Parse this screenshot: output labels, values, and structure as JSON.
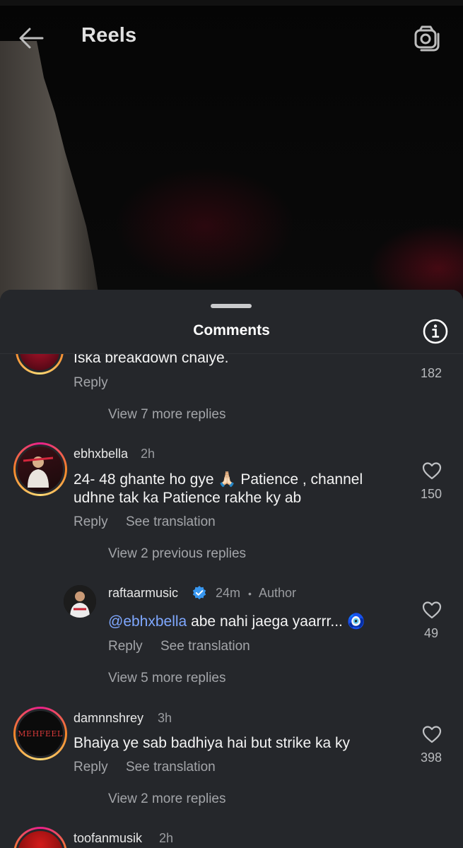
{
  "header": {
    "title": "Reels",
    "back_icon": "arrow-left-icon",
    "camera_icon": "camera-icon"
  },
  "sheet": {
    "title": "Comments",
    "info_icon": "info-icon"
  },
  "comments": [
    {
      "text": "Iska breakdown chaiye.",
      "reply_label": "Reply",
      "likes": "182",
      "view_replies": "View 7 more replies"
    },
    {
      "username": "ebhxbella",
      "time": "2h",
      "text_before": "24- 48 ghante ho gye ",
      "emoji": "🙏🏻",
      "text_after": " Patience , channel udhne tak ka Patience rakhe ky ab",
      "reply_label": "Reply",
      "translate_label": "See translation",
      "likes": "150",
      "view_previous": "View 2 previous replies"
    },
    {
      "username": "raftaarmusic",
      "time": "24m",
      "author_label": "Author",
      "mention": "@ebhxbella",
      "text": " abe nahi jaega yaarrr... ",
      "emoji": "🧿",
      "reply_label": "Reply",
      "translate_label": "See translation",
      "likes": "49",
      "view_replies": "View 5 more replies"
    },
    {
      "username": "damnnshrey",
      "time": "3h",
      "avatar_text": "MEHFEEL",
      "text": "Bhaiya ye sab badhiya hai but strike ka ky",
      "reply_label": "Reply",
      "translate_label": "See translation",
      "likes": "398",
      "view_replies": "View 2 more replies"
    },
    {
      "username": "toofanmusik",
      "time": "2h"
    }
  ],
  "colors": {
    "sheet_bg": "#25272b",
    "mention": "#7fa8ff",
    "verified": "#3897f0",
    "muted": "#a3a5a9"
  }
}
